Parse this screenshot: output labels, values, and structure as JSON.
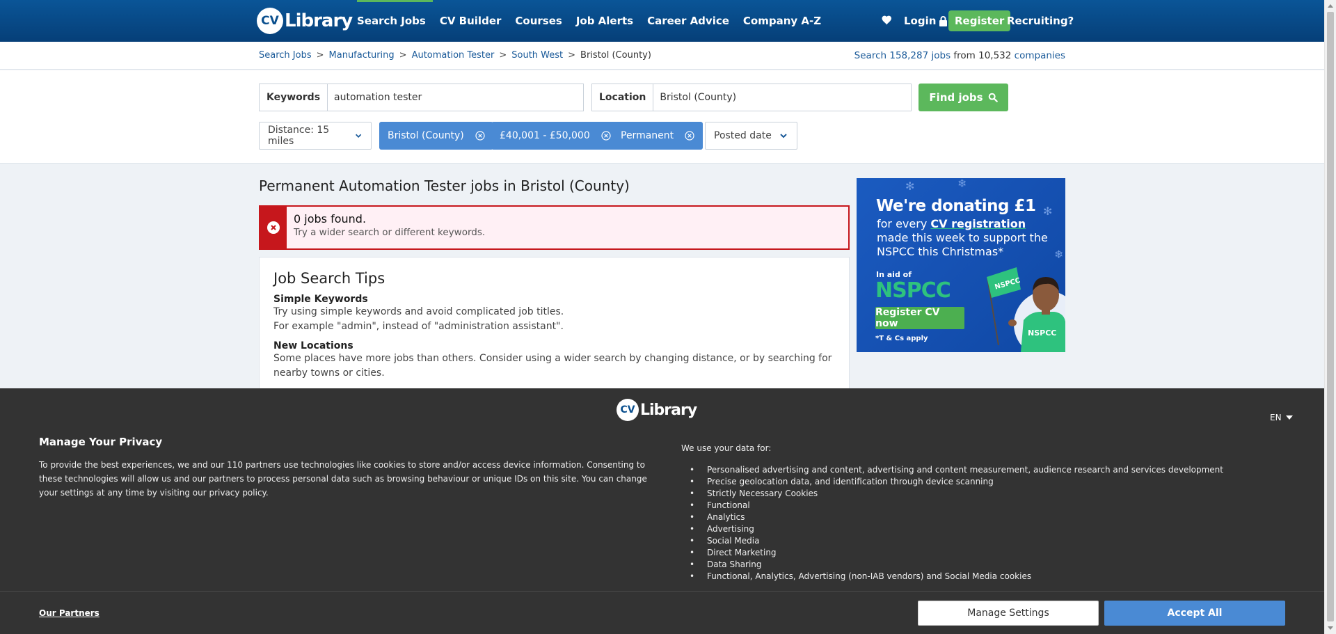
{
  "header": {
    "logo_badge": "CV",
    "logo_word": "Library",
    "nav": [
      "Search Jobs",
      "CV Builder",
      "Courses",
      "Job Alerts",
      "Career Advice",
      "Company A-Z"
    ],
    "login": "Login",
    "register": "Register",
    "recruiting": "Recruiting?"
  },
  "breadcrumb": {
    "items": [
      "Search Jobs",
      "Manufacturing",
      "Automation Tester",
      "South West"
    ],
    "current": "Bristol (County)",
    "separator": ">"
  },
  "stats": {
    "prefix": "Search",
    "jobs_count": "158,287",
    "jobs_label": "jobs",
    "from": "from",
    "companies_count": "10,532",
    "companies_label": "companies"
  },
  "search": {
    "keywords_label": "Keywords",
    "keywords_value": "automation tester",
    "location_label": "Location",
    "location_value": "Bristol (County)",
    "find_button": "Find jobs"
  },
  "filters": {
    "distance": "Distance: 15 miles",
    "chips": [
      "Bristol (County)",
      "£40,001 - £50,000",
      "Permanent"
    ],
    "posted_date": "Posted date"
  },
  "main": {
    "title": "Permanent Automation Tester jobs in Bristol (County)",
    "alert_title": "0 jobs found.",
    "alert_sub": "Try a wider search or different keywords.",
    "tips_title": "Job Search Tips",
    "tip1_head": "Simple Keywords",
    "tip1_line1": "Try using simple keywords and avoid complicated job titles.",
    "tip1_line2": "For example \"admin\", instead of \"administration assistant\".",
    "tip2_head": "New Locations",
    "tip2_line1": "Some places have more jobs than others. Consider using a wider search by changing distance, or by searching for nearby towns or cities."
  },
  "ad": {
    "headline": "We're donating £1",
    "line1_pre": "for every ",
    "line1_link": "CV registration",
    "line2": "made this week to support the NSPCC this Christmas*",
    "in_aid": "In aid of",
    "nspcc": "NSPCC",
    "button": "Register CV now",
    "tcs": "*T & Cs apply",
    "flag_text": "NSPCC",
    "shirt_text": "NSPCC"
  },
  "privacy": {
    "lang": "EN",
    "title": "Manage Your Privacy",
    "text": "To provide the best experiences, we and our 110 partners use technologies like cookies to store and/or access device information. Consenting to these technologies will allow us and our partners to process personal data such as browsing behaviour or unique IDs on this site. You can change your settings at any time by visiting our privacy policy.",
    "uses_title": "We use your data for:",
    "uses": [
      "Personalised advertising and content, advertising and content measurement, audience research and services development",
      "Precise geolocation data, and identification through device scanning",
      "Strictly Necessary Cookies",
      "Functional",
      "Analytics",
      "Advertising",
      "Social Media",
      "Direct Marketing",
      "Data Sharing",
      "Functional, Analytics, Advertising (non-IAB vendors) and Social Media cookies"
    ],
    "partners": "Our Partners",
    "manage": "Manage Settings",
    "accept": "Accept All"
  },
  "colors": {
    "brand_blue": "#0a5597",
    "accent_green": "#5cb85c",
    "chip_blue": "#4a8ad4",
    "alert_red": "#c6171c",
    "banner_dark": "#333333"
  },
  "icons": [
    "heart-icon",
    "lock-icon",
    "search-icon",
    "chevron-down-icon",
    "close-circle-icon",
    "error-icon",
    "caret-down-icon"
  ]
}
